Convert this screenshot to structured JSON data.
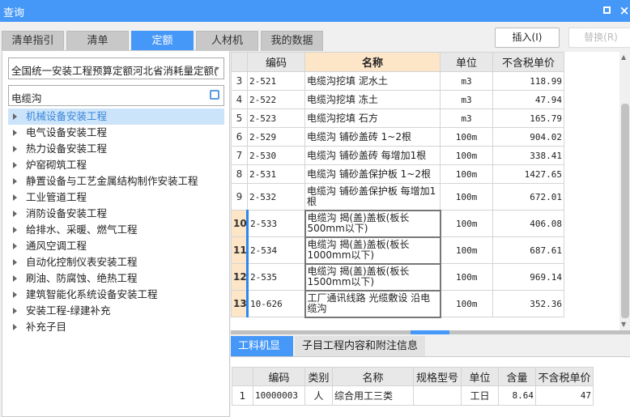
{
  "window": {
    "title": "查询",
    "controls": [
      "maximize-icon",
      "close-icon"
    ]
  },
  "tabs": [
    {
      "label": "清单指引"
    },
    {
      "label": "清单"
    },
    {
      "label": "定额",
      "active": true
    },
    {
      "label": "人材机"
    },
    {
      "label": "我的数据"
    }
  ],
  "buttons": {
    "insert": "插入(I)",
    "replace": "替换(R)"
  },
  "left": {
    "library": "全国统一安装工程预算定额河北省消耗量定额(",
    "search_value": "电缆沟",
    "tree": [
      "机械设备安装工程",
      "电气设备安装工程",
      "热力设备安装工程",
      "炉窑砌筑工程",
      "静置设备与工艺金属结构制作安装工程",
      "工业管道工程",
      "消防设备安装工程",
      "给排水、采暖、燃气工程",
      "通风空调工程",
      "自动化控制仪表安装工程",
      "刷油、防腐蚀、绝热工程",
      "建筑智能化系统设备安装工程",
      "安装工程-绿建补充",
      "补充子目"
    ],
    "selected_index": 0
  },
  "grid": {
    "headers": [
      "",
      "编码",
      "名称",
      "单位",
      "不含税单价"
    ],
    "rows": [
      [
        "3",
        "2-521",
        "电缆沟挖填 泥水土",
        "m3",
        "118.99"
      ],
      [
        "4",
        "2-522",
        "电缆沟挖填 冻土",
        "m3",
        "47.94"
      ],
      [
        "5",
        "2-523",
        "电缆沟挖填 石方",
        "m3",
        "165.79"
      ],
      [
        "6",
        "2-529",
        "电缆沟 铺砂盖砖 1~2根",
        "100m",
        "904.02"
      ],
      [
        "7",
        "2-530",
        "电缆沟 铺砂盖砖 每增加1根",
        "100m",
        "338.41"
      ],
      [
        "8",
        "2-531",
        "电缆沟 铺砂盖保护板 1~2根",
        "100m",
        "1427.65"
      ],
      [
        "9",
        "2-532",
        "电缆沟 铺砂盖保护板 每增加1根",
        "100m",
        "672.01"
      ],
      [
        "10",
        "2-533",
        "电缆沟 揭(盖)盖板(板长500mm以下)",
        "100m",
        "406.08"
      ],
      [
        "11",
        "2-534",
        "电缆沟 揭(盖)盖板(板长1000mm以下)",
        "100m",
        "687.61"
      ],
      [
        "12",
        "2-535",
        "电缆沟 揭(盖)盖板(板长1500mm以下)",
        "100m",
        "969.14"
      ],
      [
        "13",
        "10-626",
        "工厂通讯线路 光缆敷设 沿电缆沟",
        "100m",
        "352.36"
      ]
    ]
  },
  "bottom": {
    "tabs": [
      {
        "label": "工料机显示",
        "active": true
      },
      {
        "label": "子目工程内容和附注信息"
      }
    ],
    "headers": [
      "",
      "编码",
      "类别",
      "名称",
      "规格型号",
      "单位",
      "含量",
      "不含税单价"
    ],
    "rows": [
      [
        "1",
        "10000003",
        "人",
        "综合用工三类",
        "",
        "工日",
        "8.64",
        "47"
      ]
    ]
  },
  "colors": {
    "accent": "#4698f8",
    "selected_header": "#fde6c8"
  }
}
